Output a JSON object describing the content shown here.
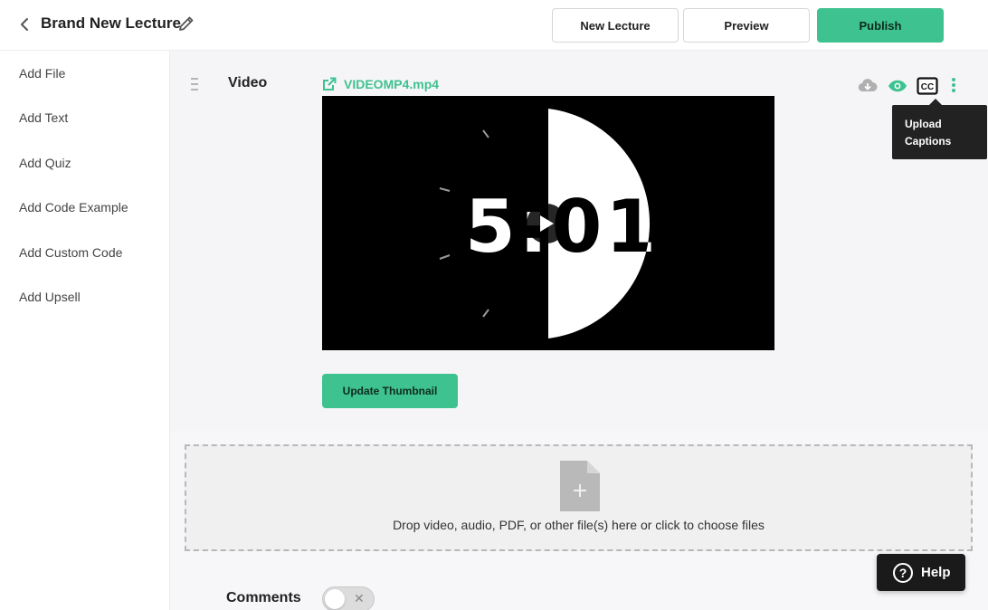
{
  "header": {
    "title": "Brand New Lecture",
    "new_lecture_label": "New Lecture",
    "preview_label": "Preview",
    "publish_label": "Publish"
  },
  "sidebar": {
    "items": [
      {
        "label": "Add File"
      },
      {
        "label": "Add Text"
      },
      {
        "label": "Add Quiz"
      },
      {
        "label": "Add Code Example"
      },
      {
        "label": "Add Custom Code"
      },
      {
        "label": "Add Upsell"
      }
    ]
  },
  "video_block": {
    "label": "Video",
    "file_name": "VIDEOMP4.mp4",
    "countdown_text": "5:01",
    "update_thumbnail_label": "Update Thumbnail",
    "tooltip": "Upload Captions",
    "cc_label": "CC"
  },
  "dropzone": {
    "text": "Drop video, audio, PDF, or other file(s) here or click to choose files"
  },
  "comments": {
    "label": "Comments",
    "enabled": false
  },
  "help": {
    "label": "Help"
  },
  "colors": {
    "accent": "#3ec28f",
    "dark": "#222222"
  },
  "icons": [
    "chevron-left-icon",
    "pencil-icon",
    "external-link-icon",
    "cloud-download-icon",
    "eye-icon",
    "closed-captions-icon",
    "more-vertical-icon",
    "file-add-icon",
    "question-circle-icon",
    "play-icon",
    "drag-handle-icon"
  ]
}
